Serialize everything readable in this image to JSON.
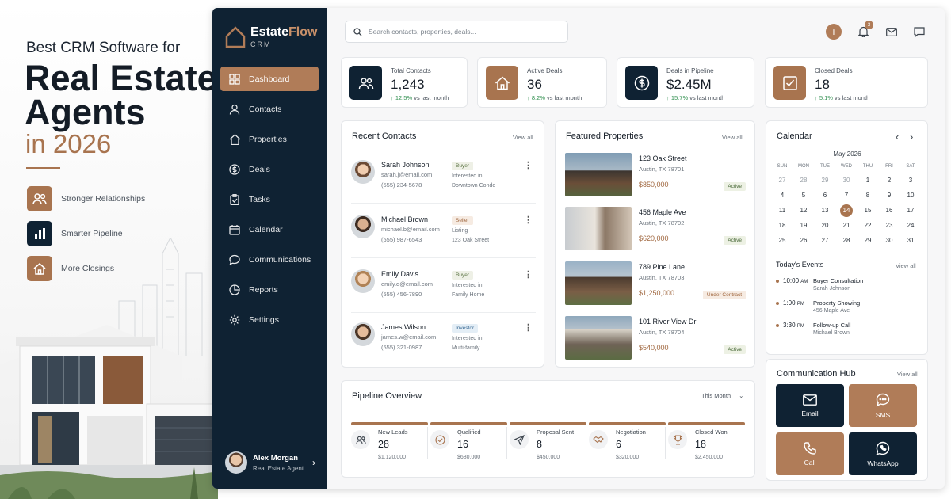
{
  "promo": {
    "subtitle": "Best CRM Software for",
    "headline1": "Real Estate",
    "headline2": "Agents",
    "year": "in 2026",
    "features": [
      {
        "label": "Stronger Relationships",
        "icon": "users-icon",
        "color": "#a8744f"
      },
      {
        "label": "Smarter Pipeline",
        "icon": "bar-chart-icon",
        "color": "#0f2233"
      },
      {
        "label": "More Closings",
        "icon": "home-icon",
        "color": "#a8744f"
      }
    ]
  },
  "brand": {
    "name_a": "Estate",
    "name_b": "Flow",
    "sub": "CRM"
  },
  "nav": [
    {
      "label": "Dashboard",
      "icon": "dashboard-icon",
      "active": true
    },
    {
      "label": "Contacts",
      "icon": "user-icon"
    },
    {
      "label": "Properties",
      "icon": "home-icon"
    },
    {
      "label": "Deals",
      "icon": "dollar-icon"
    },
    {
      "label": "Tasks",
      "icon": "clipboard-icon"
    },
    {
      "label": "Calendar",
      "icon": "calendar-icon"
    },
    {
      "label": "Communications",
      "icon": "chat-icon"
    },
    {
      "label": "Reports",
      "icon": "pie-chart-icon"
    },
    {
      "label": "Settings",
      "icon": "gear-icon"
    }
  ],
  "user": {
    "name": "Alex Morgan",
    "role": "Real Estate Agent"
  },
  "search": {
    "placeholder": "Search contacts, properties, deals..."
  },
  "header": {
    "notifications": "3"
  },
  "stats": [
    {
      "label": "Total Contacts",
      "value": "1,243",
      "change": "12.5%",
      "suffix": "vs last month",
      "icon": "users-icon",
      "bg": "#0f2233"
    },
    {
      "label": "Active Deals",
      "value": "36",
      "change": "8.2%",
      "suffix": "vs last month",
      "icon": "home-icon",
      "bg": "#a8744f"
    },
    {
      "label": "Deals in Pipeline",
      "value": "$2.45M",
      "change": "15.7%",
      "suffix": "vs last month",
      "icon": "dollar-icon",
      "bg": "#0f2233"
    },
    {
      "label": "Closed Deals",
      "value": "18",
      "change": "5.1%",
      "suffix": "vs last month",
      "icon": "check-icon",
      "bg": "#a8744f"
    }
  ],
  "recent_contacts": {
    "title": "Recent Contacts",
    "view_all": "View all",
    "items": [
      {
        "name": "Sarah Johnson",
        "email": "sarah.j@email.com",
        "phone": "(555) 234-5678",
        "tag": "Buyer",
        "line1": "Interested in",
        "line2": "Downtown Condo"
      },
      {
        "name": "Michael Brown",
        "email": "michael.b@email.com",
        "phone": "(555) 987-6543",
        "tag": "Seller",
        "line1": "Listing",
        "line2": "123 Oak Street"
      },
      {
        "name": "Emily Davis",
        "email": "emily.d@email.com",
        "phone": "(555) 456-7890",
        "tag": "Buyer",
        "line1": "Interested in",
        "line2": "Family Home"
      },
      {
        "name": "James Wilson",
        "email": "james.w@email.com",
        "phone": "(555) 321-0987",
        "tag": "Investor",
        "line1": "Interested in",
        "line2": "Multi-family"
      }
    ]
  },
  "featured_properties": {
    "title": "Featured Properties",
    "view_all": "View all",
    "items": [
      {
        "address": "123 Oak Street",
        "city": "Austin, TX 78701",
        "price": "$850,000",
        "status": "Active"
      },
      {
        "address": "456 Maple Ave",
        "city": "Austin, TX 78702",
        "price": "$620,000",
        "status": "Active"
      },
      {
        "address": "789 Pine Lane",
        "city": "Austin, TX 78703",
        "price": "$1,250,000",
        "status": "Under Contract"
      },
      {
        "address": "101 River View Dr",
        "city": "Austin, TX 78704",
        "price": "$540,000",
        "status": "Active"
      }
    ]
  },
  "calendar": {
    "title": "Calendar",
    "month": "May 2026",
    "weekdays": [
      "SUN",
      "MON",
      "TUE",
      "WED",
      "THU",
      "FRI",
      "SAT"
    ],
    "days": [
      [
        "27",
        "28",
        "29",
        "30",
        "1",
        "2",
        "3"
      ],
      [
        "4",
        "5",
        "6",
        "7",
        "8",
        "9",
        "10"
      ],
      [
        "11",
        "12",
        "13",
        "14",
        "15",
        "16",
        "17"
      ],
      [
        "18",
        "19",
        "20",
        "21",
        "22",
        "23",
        "24"
      ],
      [
        "25",
        "26",
        "27",
        "28",
        "29",
        "30",
        "31"
      ]
    ],
    "today": "14",
    "events_title": "Today's Events",
    "events_view_all": "View all",
    "events": [
      {
        "time": "10:00",
        "ampm": "AM",
        "title": "Buyer Consultation",
        "sub": "Sarah Johnson"
      },
      {
        "time": "1:00",
        "ampm": "PM",
        "title": "Property Showing",
        "sub": "456 Maple Ave"
      },
      {
        "time": "3:30",
        "ampm": "PM",
        "title": "Follow-up Call",
        "sub": "Michael Brown"
      }
    ]
  },
  "pipeline": {
    "title": "Pipeline Overview",
    "range": "This Month",
    "stages": [
      {
        "label": "New Leads",
        "count": "28",
        "amount": "$1,120,000",
        "icon": "users-icon"
      },
      {
        "label": "Qualified",
        "count": "16",
        "amount": "$680,000",
        "icon": "check-circle-icon"
      },
      {
        "label": "Proposal Sent",
        "count": "8",
        "amount": "$450,000",
        "icon": "send-icon"
      },
      {
        "label": "Negotiation",
        "count": "6",
        "amount": "$320,000",
        "icon": "handshake-icon"
      },
      {
        "label": "Closed Won",
        "count": "18",
        "amount": "$2,450,000",
        "icon": "trophy-icon"
      }
    ]
  },
  "hub": {
    "title": "Communication Hub",
    "view_all": "View all",
    "items": [
      {
        "label": "Email",
        "icon": "mail-icon",
        "bg": "#0f2233"
      },
      {
        "label": "SMS",
        "icon": "chat-icon",
        "bg": "#b07c58"
      },
      {
        "label": "Call",
        "icon": "phone-icon",
        "bg": "#b07c58"
      },
      {
        "label": "WhatsApp",
        "icon": "whatsapp-icon",
        "bg": "#0f2233"
      }
    ]
  }
}
